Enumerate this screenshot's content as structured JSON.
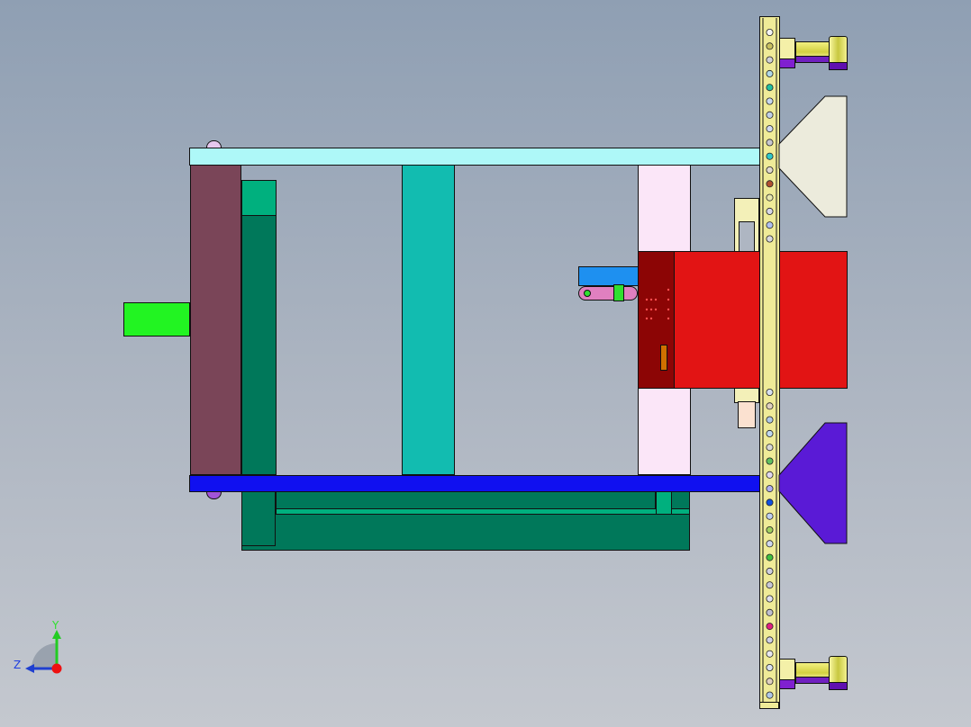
{
  "viewport": {
    "background_top": "#8f9fb3",
    "background_bottom": "#c4c8cf"
  },
  "triad": {
    "y_label": "Y",
    "z_label": "Z",
    "y_color": "#22cc22",
    "z_color": "#1f3fd0",
    "x_color": "#ee1111"
  },
  "colors": {
    "top_bar": "#aef8f8",
    "bottom_bar": "#1010f0",
    "left_plate": "#7a4558",
    "green_dark": "#00785a",
    "green_light": "#00b07e",
    "teal_column": "#12bcb0",
    "nozzle_green": "#22f422",
    "pink_column": "#fbe6f8",
    "red_block": "#e21414",
    "red_dark": "#8c0505",
    "rail": "#efeb98",
    "hopper_top": "#ecebdc",
    "hopper_bottom": "#5a1ad6",
    "pin": "#dede50"
  }
}
